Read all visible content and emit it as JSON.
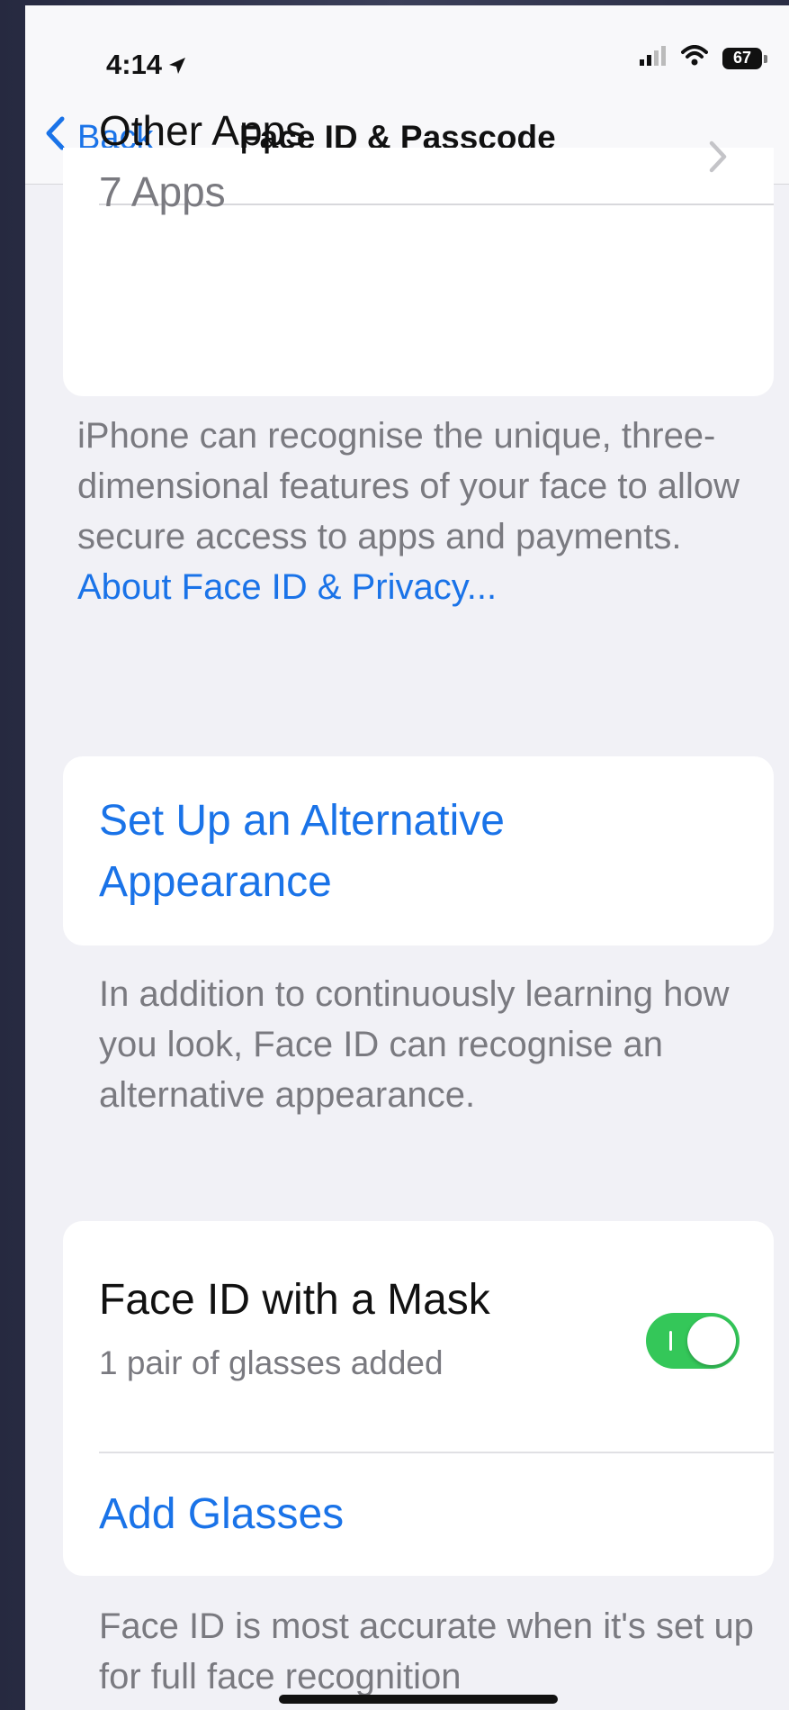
{
  "status_bar": {
    "time": "4:14",
    "battery": "67"
  },
  "nav": {
    "back_label": "Back",
    "title": "Face ID & Passcode"
  },
  "other_apps": {
    "title": "Other Apps",
    "subtitle": "7 Apps"
  },
  "face_id_footer": {
    "text": "iPhone can recognise the unique, three-dimensional features of your face to allow secure access to apps and payments. ",
    "link": "About Face ID & Privacy..."
  },
  "alternative": {
    "link": "Set Up an Alternative Appearance",
    "footer": "In addition to continuously learning how you look, Face ID can recognise an alternative appearance."
  },
  "mask": {
    "title": "Face ID with a Mask",
    "subtitle": "1 pair of glasses added",
    "toggle_on": true,
    "add_glasses": "Add Glasses",
    "footer": "Face ID is most accurate when it's set up for full face recognition"
  },
  "colors": {
    "accent": "#1a73e8",
    "toggle_on": "#34c759"
  }
}
